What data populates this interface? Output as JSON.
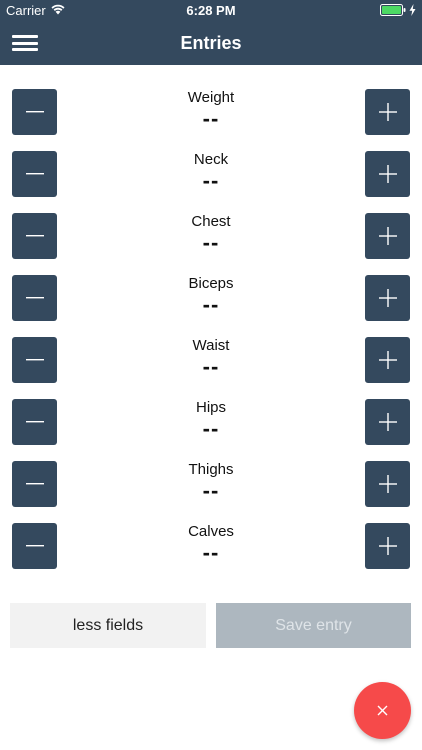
{
  "status_bar": {
    "carrier": "Carrier",
    "time": "6:28 PM",
    "battery_color": "#4cd964"
  },
  "nav": {
    "title": "Entries",
    "menu_icon": "hamburger-icon"
  },
  "colors": {
    "primary": "#34495e",
    "fab": "#f64a4a",
    "save_disabled": "#adb7bf"
  },
  "fields": [
    {
      "label": "Weight",
      "value": "--"
    },
    {
      "label": "Neck",
      "value": "--"
    },
    {
      "label": "Chest",
      "value": "--"
    },
    {
      "label": "Biceps",
      "value": "--"
    },
    {
      "label": "Waist",
      "value": "--"
    },
    {
      "label": "Hips",
      "value": "--"
    },
    {
      "label": "Thighs",
      "value": "--"
    },
    {
      "label": "Calves",
      "value": "--"
    }
  ],
  "actions": {
    "less_fields_label": "less fields",
    "save_entry_label": "Save entry"
  },
  "fab": {
    "icon": "close-icon"
  }
}
